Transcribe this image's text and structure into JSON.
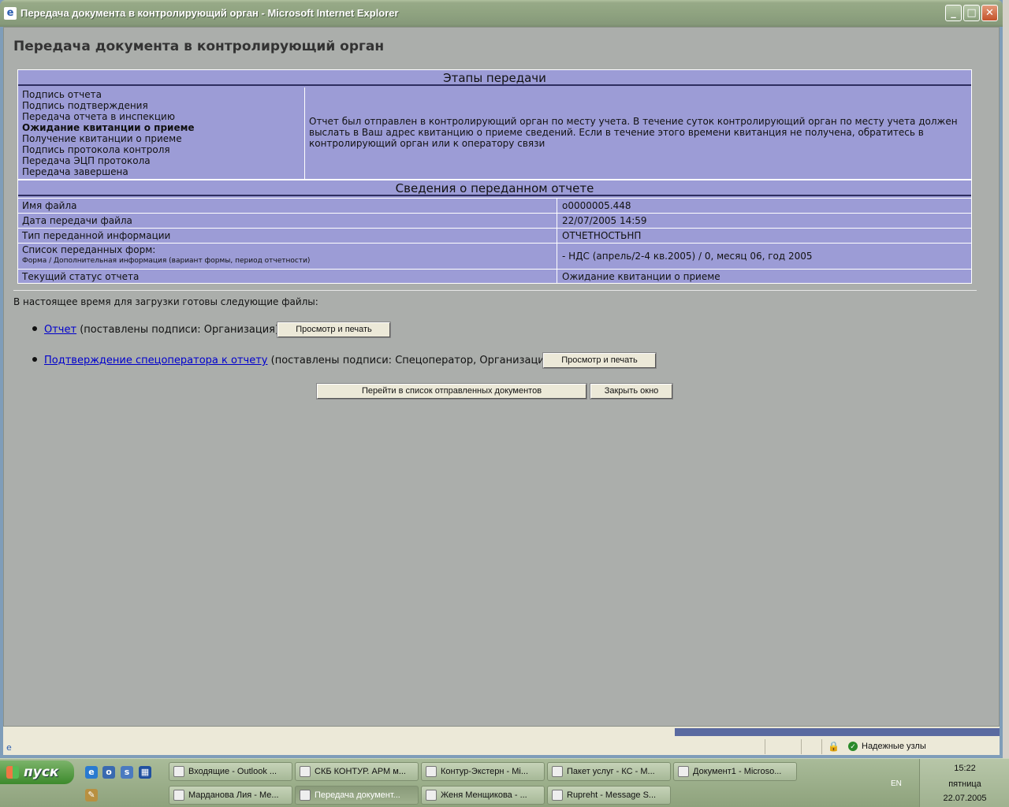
{
  "window": {
    "title": "Передача документа в контролирующий орган - Microsoft Internet Explorer",
    "min_label": "_",
    "max_label": "□",
    "close_label": "✕"
  },
  "page": {
    "title": "Передача документа в контролирующий орган"
  },
  "stages": {
    "header": "Этапы передачи",
    "items": [
      "Подпись отчета",
      "Подпись подтверждения",
      "Передача отчета в инспекцию",
      "Ожидание квитанции о приеме",
      "Получение квитанции о приеме",
      "Подпись протокола контроля",
      "Передача ЭЦП протокола",
      "Передача завершена"
    ],
    "current_index": 3,
    "message": "Отчет был отправлен в контролирующий орган по месту учета. В течение суток контролирующий орган по месту учета должен выслать в Ваш адрес квитанцию о приеме сведений. Если в течение этого времени квитанция не получена, обратитесь в контролирующий орган или к оператору связи"
  },
  "report_info": {
    "header": "Сведения о переданном отчете",
    "rows": [
      {
        "key": "Имя файла",
        "value": "o0000005.448"
      },
      {
        "key": "Дата передачи файла",
        "value": "22/07/2005 14:59"
      },
      {
        "key": "Тип переданной информации",
        "value": "ОТЧЕТНОСТЬНП"
      },
      {
        "key": "Список переданных форм:",
        "sub": "Форма / Дополнительная информация (вариант формы, период отчетности)",
        "value": "- НДС (апрель/2-4 кв.2005) / 0, месяц 06, год 2005"
      },
      {
        "key": "Текущий статус отчета",
        "value": "Ожидание квитанции о приеме"
      }
    ]
  },
  "files": {
    "intro": "В настоящее время для загрузки готовы следующие файлы:",
    "items": [
      {
        "link": "Отчет",
        "note": "(поставлены подписи: Организация)",
        "button": "Просмотр и печать"
      },
      {
        "link": "Подтверждение спецоператора к отчету",
        "note": "(поставлены подписи: Спецоператор, Организация)",
        "button": "Просмотр и печать"
      }
    ]
  },
  "actions": {
    "goto_list": "Перейти в список отправленных документов",
    "close_window": "Закрыть окно"
  },
  "statusbar": {
    "zone": "Надежные узлы"
  },
  "taskbar": {
    "start": "пуск",
    "tasks_row1": [
      "Входящие - Outlook ...",
      "СКБ КОНТУР. АРМ м...",
      "Контур-Экстерн - Mi...",
      "Пакет услуг - КС - М...",
      "Документ1 - Microso..."
    ],
    "tasks_row2": [
      "Марданова Лия - Ме...",
      "Передача документ...",
      "Женя Менщикова - ...",
      "Ruprеht - Message S..."
    ],
    "active_task": "Передача документ...",
    "lang": "EN",
    "time": "15:22",
    "weekday": "пятница",
    "date": "22.07.2005"
  }
}
